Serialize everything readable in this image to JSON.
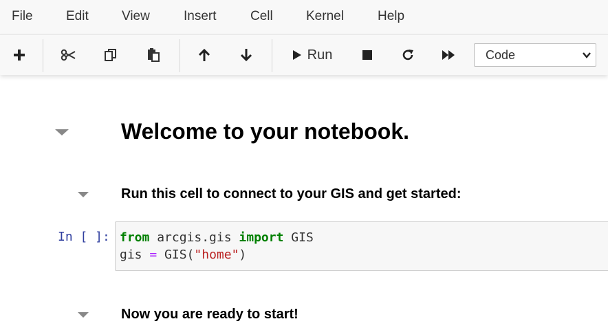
{
  "menu": {
    "items": [
      {
        "label": "File"
      },
      {
        "label": "Edit"
      },
      {
        "label": "View"
      },
      {
        "label": "Insert"
      },
      {
        "label": "Cell"
      },
      {
        "label": "Kernel"
      },
      {
        "label": "Help"
      }
    ]
  },
  "toolbar": {
    "run_label": "Run",
    "cell_type": "Code"
  },
  "notebook": {
    "heading": "Welcome to your notebook.",
    "subheading": "Run this cell to connect to your GIS and get started:",
    "prompt": "In [ ]:",
    "code": {
      "line1": {
        "kw1": "from",
        "mod": " arcgis.gis ",
        "kw2": "import",
        "name": " GIS"
      },
      "line2": {
        "var": "gis ",
        "op": "=",
        "call": " GIS(",
        "str": "\"home\"",
        "close": ")"
      }
    },
    "footer_heading": "Now you are ready to start!"
  },
  "colors": {
    "prompt": "#303f9f",
    "keyword": "#008000",
    "operator": "#aa22ff",
    "string": "#ba2121",
    "toolbar_bg": "#f8f8f8"
  }
}
